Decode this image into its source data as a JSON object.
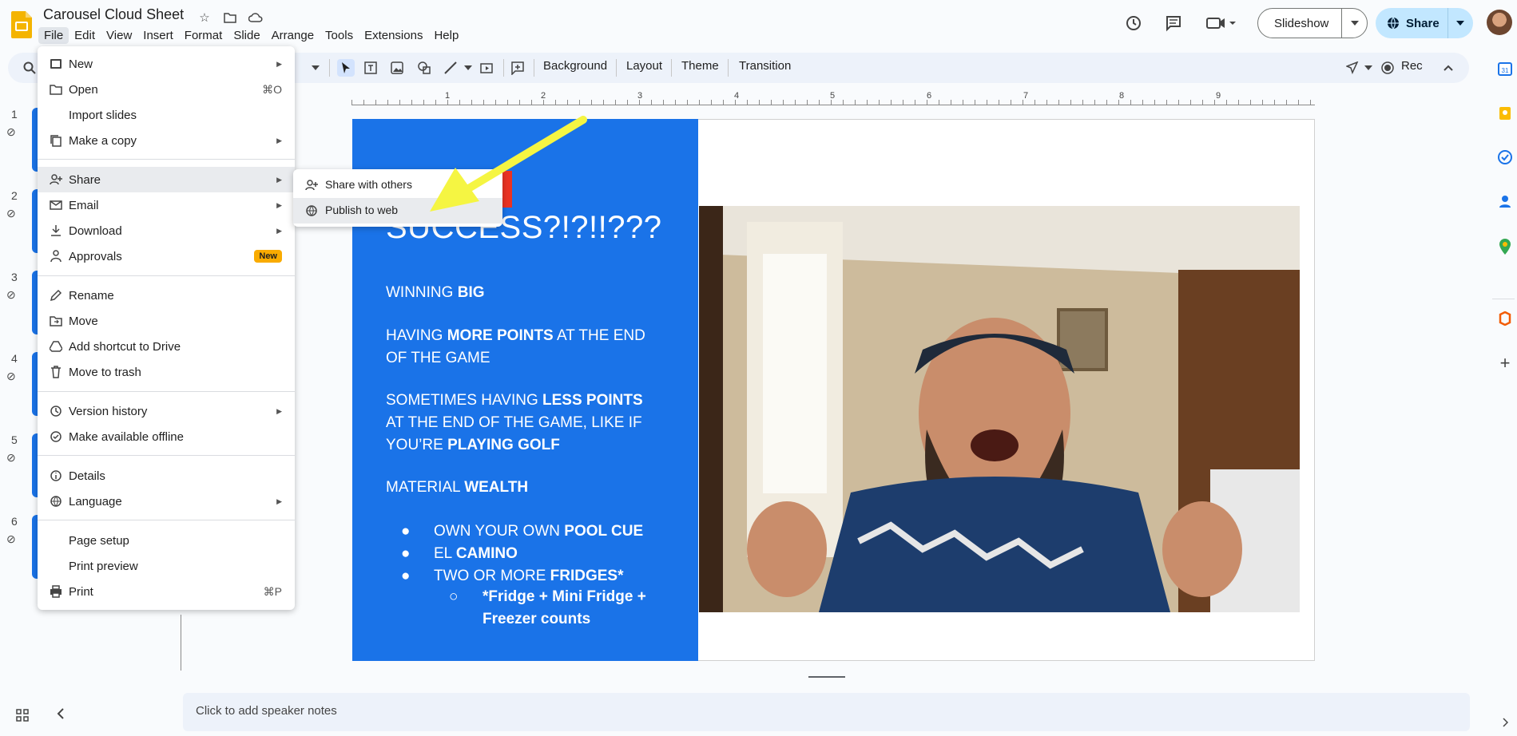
{
  "header": {
    "title": "Carousel Cloud Sheet",
    "menus": [
      "File",
      "Edit",
      "View",
      "Insert",
      "Format",
      "Slide",
      "Arrange",
      "Tools",
      "Extensions",
      "Help"
    ],
    "slideshow_label": "Slideshow",
    "share_label": "Share"
  },
  "toolbar": {
    "background_label": "Background",
    "layout_label": "Layout",
    "theme_label": "Theme",
    "transition_label": "Transition",
    "rec_label": "Rec"
  },
  "ruler": [
    "1",
    "2",
    "3",
    "4",
    "5",
    "6",
    "7",
    "8",
    "9"
  ],
  "filmstrip": [
    "1",
    "2",
    "3",
    "4",
    "5",
    "6"
  ],
  "file_menu": {
    "items": [
      {
        "label": "New",
        "icon": "new-slides-icon",
        "arrow": true
      },
      {
        "label": "Open",
        "icon": "folder-icon",
        "shortcut": "⌘O"
      },
      {
        "label": "Import slides",
        "icon": "import-icon"
      },
      {
        "label": "Make a copy",
        "icon": "copy-icon",
        "arrow": true
      },
      {
        "label": "Share",
        "icon": "person-add-icon",
        "arrow": true
      },
      {
        "label": "Email",
        "icon": "email-icon",
        "arrow": true
      },
      {
        "label": "Download",
        "icon": "download-icon",
        "arrow": true
      },
      {
        "label": "Approvals",
        "icon": "approvals-icon",
        "badge": "New"
      },
      {
        "label": "Rename",
        "icon": "rename-icon"
      },
      {
        "label": "Move",
        "icon": "move-icon"
      },
      {
        "label": "Add shortcut to Drive",
        "icon": "drive-shortcut-icon"
      },
      {
        "label": "Move to trash",
        "icon": "trash-icon"
      },
      {
        "label": "Version history",
        "icon": "history-icon",
        "arrow": true
      },
      {
        "label": "Make available offline",
        "icon": "offline-icon"
      },
      {
        "label": "Details",
        "icon": "info-icon"
      },
      {
        "label": "Language",
        "icon": "globe-icon",
        "arrow": true
      },
      {
        "label": "Page setup",
        "icon": "page-setup-icon"
      },
      {
        "label": "Print preview",
        "icon": "print-preview-icon"
      },
      {
        "label": "Print",
        "icon": "print-icon",
        "shortcut": "⌘P"
      }
    ]
  },
  "share_submenu": {
    "share_with_others": "Share with others",
    "publish_to_web": "Publish to web"
  },
  "slide": {
    "heading": "SUCCESS?!?!!???",
    "line1_a": "WINNING ",
    "line1_b": "BIG",
    "line2_a": "HAVING ",
    "line2_b": "MORE POINTS",
    "line2_c": " AT THE END",
    "line2_d": "OF THE GAME",
    "line3_a": "SOMETIMES HAVING ",
    "line3_b": "LESS POINTS",
    "line3_c": "AT THE END OF THE GAME, LIKE IF",
    "line3_d": "YOU’RE ",
    "line3_e": "PLAYING GOLF",
    "line4_a": "MATERIAL ",
    "line4_b": "WEALTH",
    "bullet1_a": "OWN YOUR OWN ",
    "bullet1_b": "POOL CUE",
    "bullet2_a": "EL ",
    "bullet2_b": "CAMINO",
    "bullet3_a": "TWO OR MORE ",
    "bullet3_b": "FRIDGES*",
    "sub1": "*Fridge + Mini Fridge +",
    "sub2": "Freezer counts"
  },
  "notes": {
    "placeholder": "Click to add speaker notes"
  },
  "colors": {
    "accent": "#1a73e8",
    "share_bg": "#c2e7ff",
    "badge": "#f9ab00",
    "arrow": "#f5f542"
  }
}
